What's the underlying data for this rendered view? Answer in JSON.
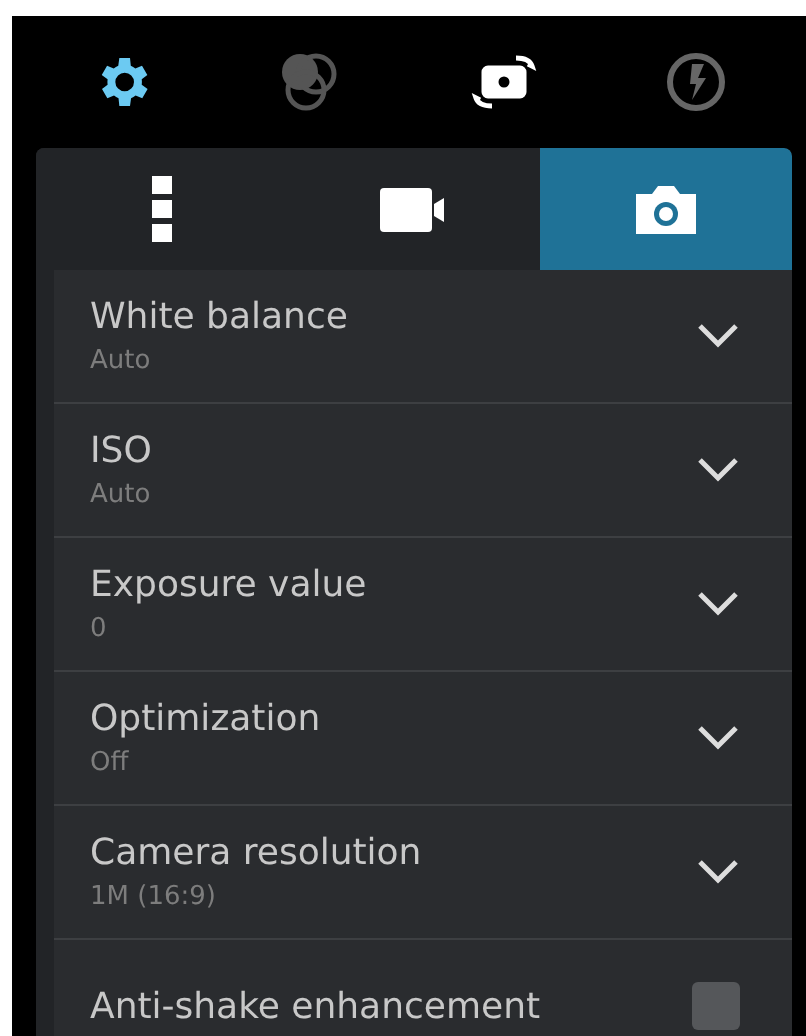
{
  "toolbar": [
    {
      "selected": true
    },
    {
      "selected": false
    },
    {
      "selected": false
    },
    {
      "selected": false
    }
  ],
  "tabs": [
    {
      "selected": false
    },
    {
      "selected": false
    },
    {
      "selected": true
    }
  ],
  "settings": [
    {
      "kind": "dropdown",
      "title": "White balance",
      "value": "Auto"
    },
    {
      "kind": "dropdown",
      "title": "ISO",
      "value": "Auto"
    },
    {
      "kind": "dropdown",
      "title": "Exposure value",
      "value": "0"
    },
    {
      "kind": "dropdown",
      "title": "Optimization",
      "value": "Off"
    },
    {
      "kind": "dropdown",
      "title": "Camera resolution",
      "value": "1M (16:9)"
    },
    {
      "kind": "checkbox",
      "title": "Anti-shake enhancement",
      "checked": false
    }
  ]
}
